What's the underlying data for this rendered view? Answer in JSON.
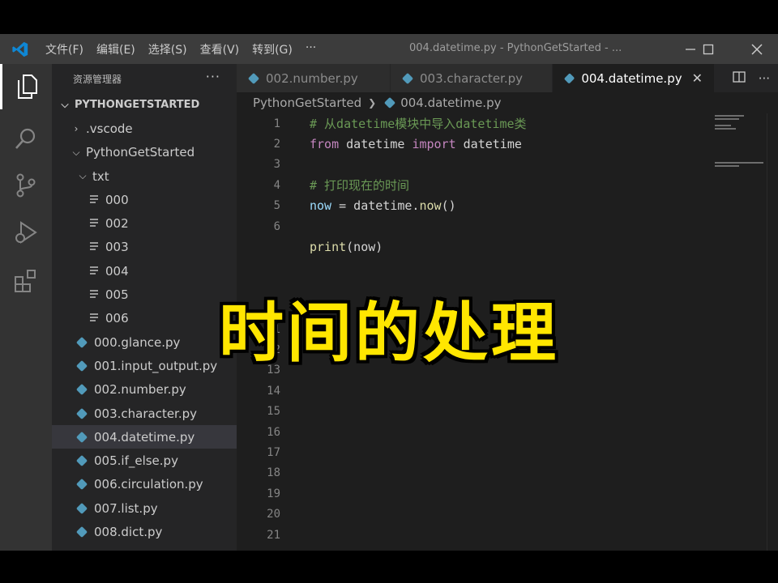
{
  "menu": [
    "文件(F)",
    "编辑(E)",
    "选择(S)",
    "查看(V)",
    "转到(G)",
    "···"
  ],
  "window_title": "004.datetime.py - PythonGetStarted - ...",
  "activity_icons": [
    "explorer-icon",
    "search-icon",
    "source-control-icon",
    "run-debug-icon",
    "extensions-icon"
  ],
  "sidebar": {
    "header": "资源管理器",
    "more": "···",
    "root": "PYTHONGETSTARTED",
    "items": [
      {
        "label": ".vscode",
        "kind": "folder-closed",
        "indent": 1
      },
      {
        "label": "PythonGetStarted",
        "kind": "folder-open",
        "indent": 1
      },
      {
        "label": "txt",
        "kind": "folder-open",
        "indent": 2
      },
      {
        "label": "000",
        "kind": "txt",
        "indent": 3
      },
      {
        "label": "002",
        "kind": "txt",
        "indent": 3
      },
      {
        "label": "003",
        "kind": "txt",
        "indent": 3
      },
      {
        "label": "004",
        "kind": "txt",
        "indent": 3
      },
      {
        "label": "005",
        "kind": "txt",
        "indent": 3
      },
      {
        "label": "006",
        "kind": "txt",
        "indent": 3
      },
      {
        "label": "000.glance.py",
        "kind": "py",
        "indent": 2
      },
      {
        "label": "001.input_output.py",
        "kind": "py",
        "indent": 2
      },
      {
        "label": "002.number.py",
        "kind": "py",
        "indent": 2
      },
      {
        "label": "003.character.py",
        "kind": "py",
        "indent": 2
      },
      {
        "label": "004.datetime.py",
        "kind": "py",
        "indent": 2,
        "selected": true
      },
      {
        "label": "005.if_else.py",
        "kind": "py",
        "indent": 2
      },
      {
        "label": "006.circulation.py",
        "kind": "py",
        "indent": 2
      },
      {
        "label": "007.list.py",
        "kind": "py",
        "indent": 2
      },
      {
        "label": "008.dict.py",
        "kind": "py",
        "indent": 2
      }
    ]
  },
  "tabs": [
    {
      "label": "002.number.py",
      "active": false
    },
    {
      "label": "003.character.py",
      "active": false
    },
    {
      "label": "004.datetime.py",
      "active": true
    }
  ],
  "tab_close": "✕",
  "breadcrumb": {
    "folder": "PythonGetStarted",
    "file": "004.datetime.py"
  },
  "code_lines": [
    {
      "n": "1",
      "tokens": [
        {
          "t": "# 从datetime模块中导入datetime类",
          "c": "comment"
        }
      ]
    },
    {
      "n": "2",
      "tokens": [
        {
          "t": "from",
          "c": "kw"
        },
        {
          "t": " datetime ",
          "c": "plain"
        },
        {
          "t": "import",
          "c": "kw"
        },
        {
          "t": " datetime",
          "c": "plain"
        }
      ]
    },
    {
      "n": "3",
      "tokens": []
    },
    {
      "n": "4",
      "tokens": [
        {
          "t": "# 打印现在的时间",
          "c": "comment"
        }
      ]
    },
    {
      "n": "5",
      "tokens": [
        {
          "t": "now",
          "c": "var"
        },
        {
          "t": " = datetime.",
          "c": "plain"
        },
        {
          "t": "now",
          "c": "fn"
        },
        {
          "t": "()",
          "c": "plain"
        }
      ]
    },
    {
      "n": "6",
      "tokens": []
    },
    {
      "n": "",
      "tokens": [
        {
          "t": "print",
          "c": "fn"
        },
        {
          "t": "(now)",
          "c": "plain"
        }
      ]
    },
    {
      "n": "",
      "tokens": []
    },
    {
      "n": "",
      "tokens": []
    },
    {
      "n": "",
      "tokens": []
    },
    {
      "n": "11",
      "tokens": []
    },
    {
      "n": "12",
      "tokens": []
    },
    {
      "n": "13",
      "tokens": []
    },
    {
      "n": "14",
      "tokens": []
    },
    {
      "n": "15",
      "tokens": []
    },
    {
      "n": "16",
      "tokens": []
    },
    {
      "n": "17",
      "tokens": []
    },
    {
      "n": "18",
      "tokens": []
    },
    {
      "n": "19",
      "tokens": []
    },
    {
      "n": "20",
      "tokens": []
    },
    {
      "n": "21",
      "tokens": []
    }
  ],
  "caption": "时间的处理",
  "colors": {
    "caption": "#ffe600",
    "accent": "#007acc",
    "py_icon": "#519aba"
  }
}
